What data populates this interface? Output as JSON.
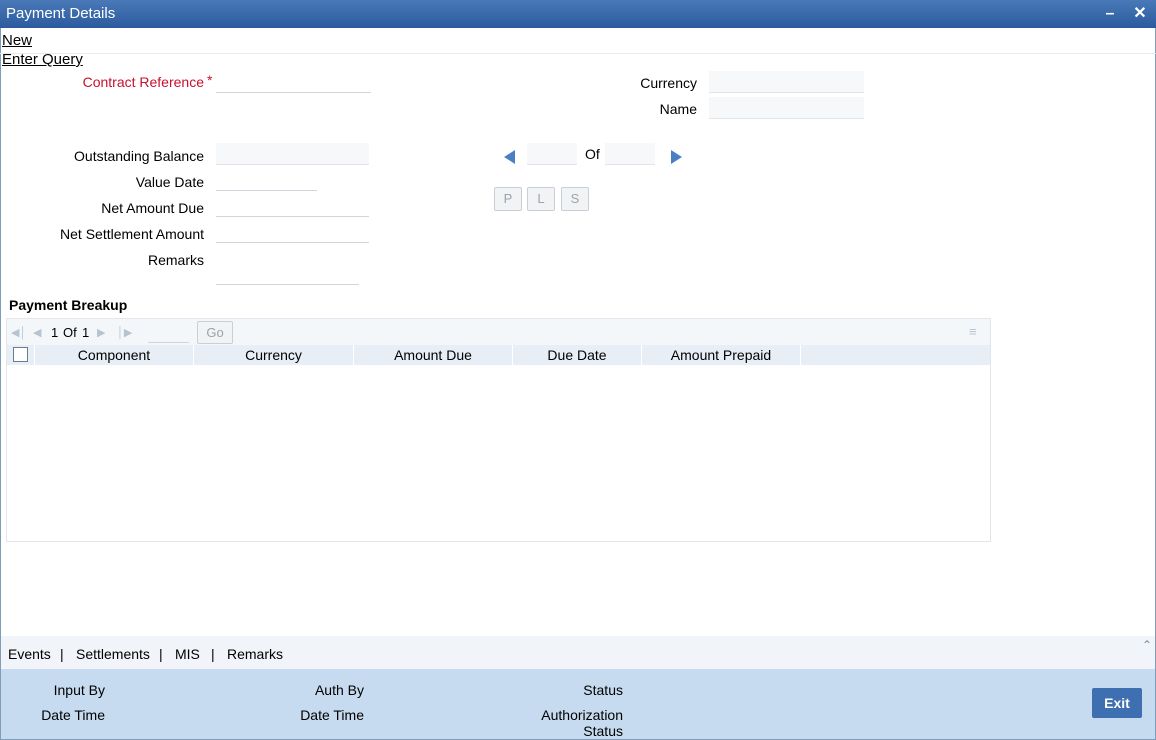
{
  "window": {
    "title": "Payment Details"
  },
  "menu": {
    "new_label": "New",
    "enter_query_label": "Enter Query"
  },
  "form": {
    "contract_reference_label": "Contract Reference",
    "required_mark": "*",
    "contract_reference_value": "",
    "currency_label": "Currency",
    "currency_value": "",
    "name_label": "Name",
    "name_value": "",
    "outstanding_balance_label": "Outstanding Balance",
    "value_date_label": "Value Date",
    "net_amount_due_label": "Net Amount Due",
    "net_settlement_amount_label": "Net Settlement Amount",
    "remarks_label": "Remarks",
    "of_label": "Of",
    "p_button": "P",
    "l_button": "L",
    "s_button": "S"
  },
  "payment_breakup": {
    "title": "Payment Breakup",
    "page_current": "1",
    "page_of": "Of",
    "page_total": "1",
    "go_label": "Go",
    "columns": [
      "Component",
      "Currency",
      "Amount Due",
      "Due Date",
      "Amount Prepaid"
    ]
  },
  "bottom_tabs": {
    "events": "Events",
    "settlements": "Settlements",
    "mis": "MIS",
    "remarks": "Remarks",
    "separator": "|"
  },
  "footer": {
    "input_by": "Input By",
    "date_time_1": "Date Time",
    "auth_by": "Auth By",
    "date_time_2": "Date Time",
    "status": "Status",
    "authorization": "Authorization",
    "authorization_status": "Status",
    "exit_label": "Exit"
  },
  "colors": {
    "titlebar": "#2b5b9e",
    "required": "#c8102e",
    "footer": "#c6dbef",
    "exit_button": "#3e6fb0",
    "nav_arrow": "#4a7fc4"
  }
}
